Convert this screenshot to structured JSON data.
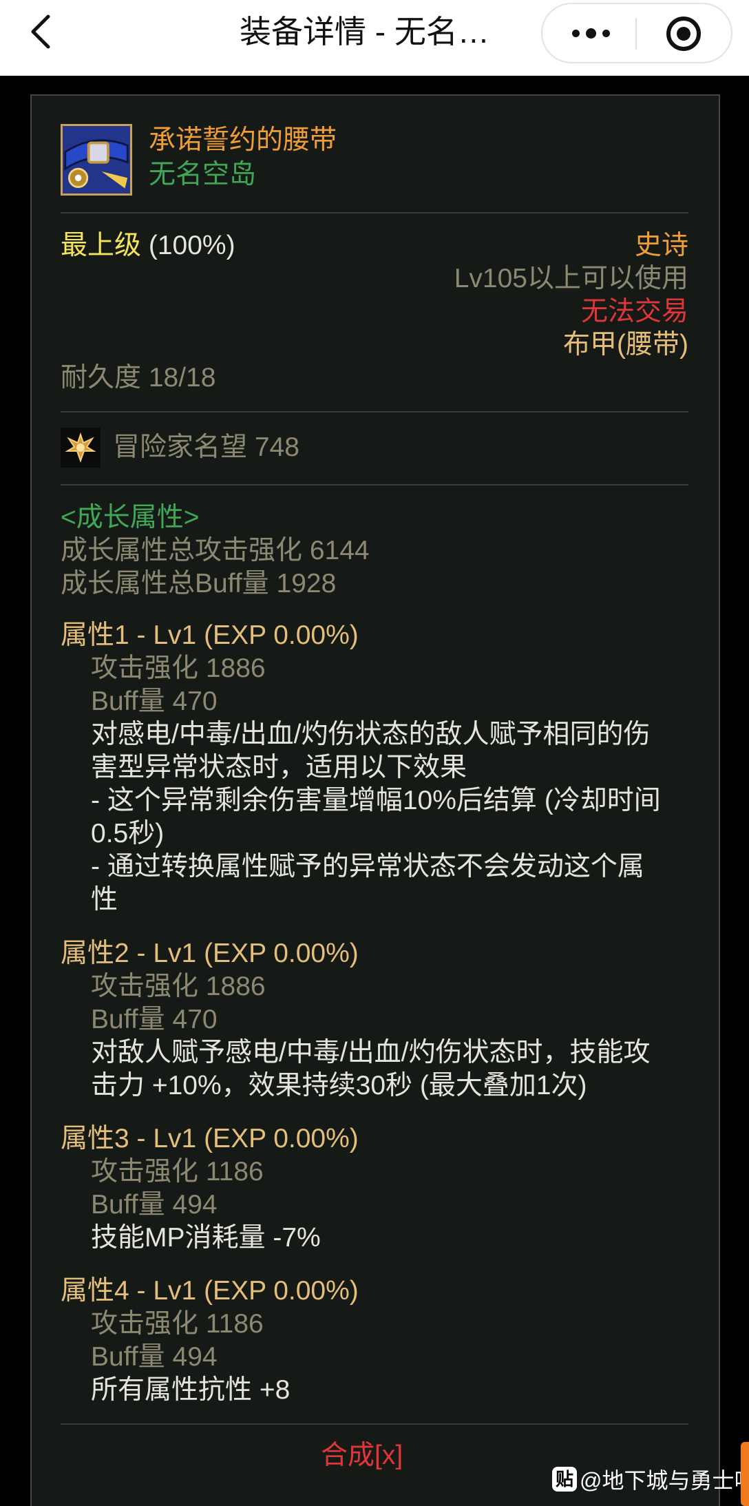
{
  "navbar": {
    "title": "装备详情 - 无名…",
    "back_icon": "chevron-left-icon",
    "more_icon": "more-dots-icon",
    "close_icon": "target-circle-icon"
  },
  "item": {
    "name": "承诺誓约的腰带",
    "set": "无名空岛",
    "grade": "最上级",
    "grade_pct": "(100%)",
    "rarity": "史诗",
    "level_req": "Lv105以上可以使用",
    "trade": "无法交易",
    "type": "布甲(腰带)",
    "durability": "耐久度 18/18",
    "fame": "冒险家名望 748"
  },
  "growth": {
    "header": "<成长属性>",
    "total_attack": "成长属性总攻击强化 6144",
    "total_buff": "成长属性总Buff量 1928"
  },
  "attrs": [
    {
      "title": "属性1 - Lv1 (EXP 0.00%)",
      "attack": "攻击强化   1886",
      "buff": "Buff量   470",
      "desc": [
        "对感电/中毒/出血/灼伤状态的敌人赋予相同的伤",
        "害型异常状态时，适用以下效果",
        "- 这个异常剩余伤害量增幅10%后结算 (冷却时间",
        "0.5秒)",
        "- 通过转换属性赋予的异常状态不会发动这个属",
        "性"
      ]
    },
    {
      "title": "属性2 - Lv1 (EXP 0.00%)",
      "attack": "攻击强化   1886",
      "buff": "Buff量   470",
      "desc": [
        "对敌人赋予感电/中毒/出血/灼伤状态时，技能攻",
        "击力 +10%，效果持续30秒 (最大叠加1次)"
      ]
    },
    {
      "title": "属性3 - Lv1 (EXP 0.00%)",
      "attack": "攻击强化   1186",
      "buff": "Buff量   494",
      "desc": [
        "技能MP消耗量 -7%"
      ]
    },
    {
      "title": "属性4 - Lv1 (EXP 0.00%)",
      "attack": "攻击强化   1186",
      "buff": "Buff量   494",
      "desc": [
        "所有属性抗性 +8"
      ]
    }
  ],
  "footer": {
    "synth": "合成[x]",
    "watermark_badge": "贴",
    "watermark": "@地下城与勇士吧"
  },
  "colors": {
    "background": "#000000",
    "panel": "#161a17",
    "gold": "#e5bf7a",
    "gray": "#8d8871",
    "green": "#3fa857",
    "red": "#e0363a",
    "orange": "#ef9e37",
    "yellow": "#f6e45c"
  }
}
